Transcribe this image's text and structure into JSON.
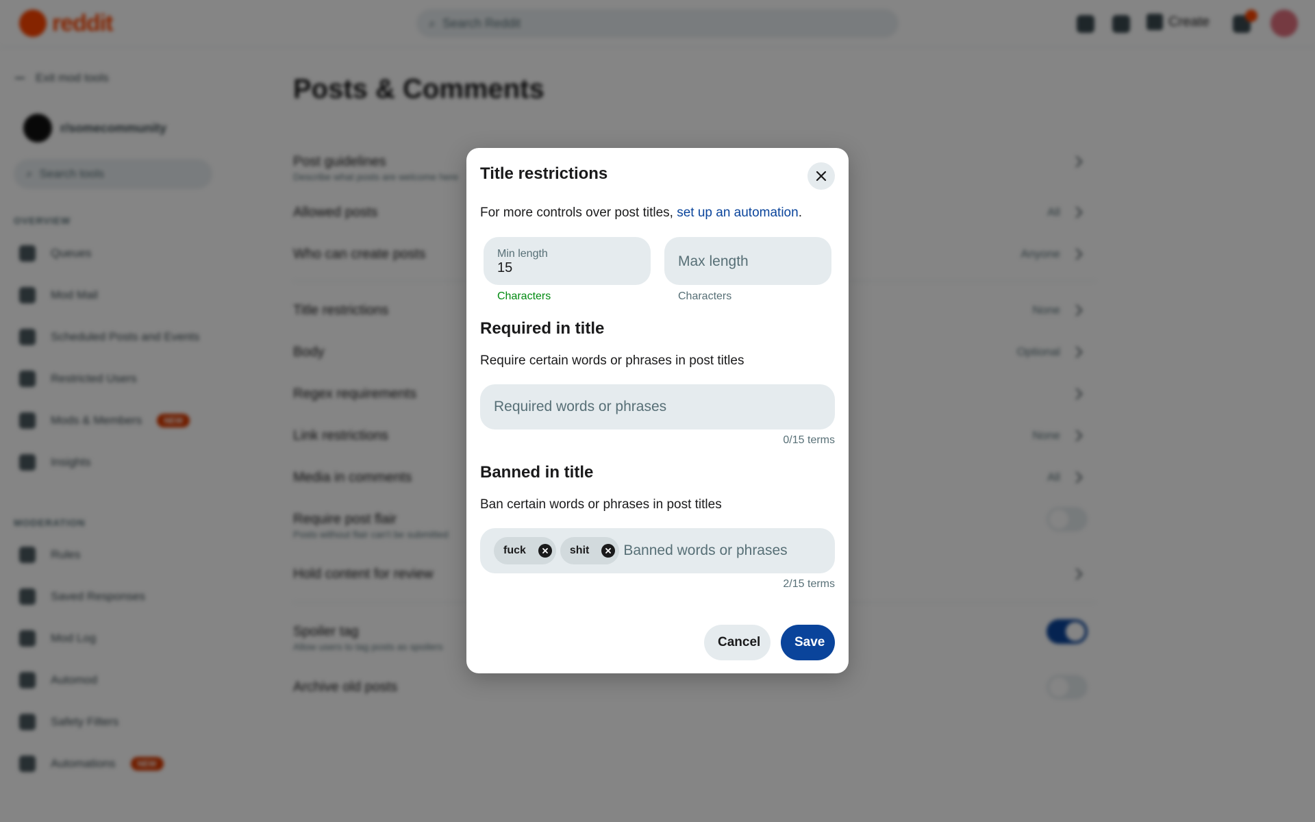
{
  "app": {
    "logo_text": "reddit",
    "search_placeholder": "Search Reddit",
    "create_label": "Create"
  },
  "sidebar": {
    "back_label": "Exit mod tools",
    "community_name": "r/somecommunity",
    "search_placeholder": "Search tools",
    "sections": [
      {
        "title": "OVERVIEW",
        "items": [
          {
            "label": "Queues"
          },
          {
            "label": "Mod Mail"
          },
          {
            "label": "Scheduled Posts and Events"
          },
          {
            "label": "Restricted Users"
          },
          {
            "label": "Mods & Members",
            "badge": "NEW"
          },
          {
            "label": "Insights"
          }
        ]
      },
      {
        "title": "MODERATION",
        "items": [
          {
            "label": "Rules"
          },
          {
            "label": "Saved Responses"
          },
          {
            "label": "Mod Log"
          },
          {
            "label": "Automod"
          },
          {
            "label": "Safety Filters"
          },
          {
            "label": "Automations",
            "badge": "NEW"
          }
        ]
      }
    ]
  },
  "main": {
    "title": "Posts & Comments",
    "settings": [
      {
        "label": "Post guidelines",
        "sub": "Describe what posts are welcome here",
        "value": ""
      },
      {
        "label": "Allowed posts",
        "value": "All"
      },
      {
        "label": "Who can create posts",
        "value": "Anyone"
      },
      {
        "label": "Title restrictions",
        "value": "None"
      },
      {
        "label": "Body",
        "value": "Optional"
      },
      {
        "label": "Regex requirements",
        "value": ""
      },
      {
        "label": "Link restrictions",
        "value": "None"
      },
      {
        "label": "Media in comments",
        "value": "All"
      },
      {
        "label": "Require post flair",
        "sub": "Posts without flair can't be submitted"
      },
      {
        "label": "Hold content for review",
        "value": ""
      },
      {
        "label": "Spoiler tag",
        "sub": "Allow users to tag posts as spoilers"
      },
      {
        "label": "Archive old posts"
      }
    ]
  },
  "modal": {
    "title": "Title restrictions",
    "intro_text": "For more controls over post titles, ",
    "intro_link": "set up an automation",
    "intro_end": ".",
    "min_length": {
      "label": "Min length",
      "value": "15",
      "help": "Characters"
    },
    "max_length": {
      "placeholder": "Max length",
      "value": "",
      "help": "Characters"
    },
    "required": {
      "heading": "Required in title",
      "description": "Require certain words or phrases in post titles",
      "placeholder": "Required words or phrases",
      "count": "0/15 terms",
      "terms": []
    },
    "banned": {
      "heading": "Banned in title",
      "description": "Ban certain words or phrases in post titles",
      "placeholder": "Banned words or phrases",
      "count": "2/15 terms",
      "terms": [
        "fuck",
        "shit"
      ]
    },
    "cancel_label": "Cancel",
    "save_label": "Save"
  },
  "colors": {
    "brand": "#ff4500",
    "link": "#0a449b",
    "primary_button": "#0a449b",
    "help_text_valid": "#008a10",
    "field_background": "#e5ebee",
    "overlay": "rgba(0,0,0,0.48)"
  },
  "icons": {
    "close": "close-icon",
    "remove_term": "remove-term-icon",
    "search": "search-icon"
  }
}
